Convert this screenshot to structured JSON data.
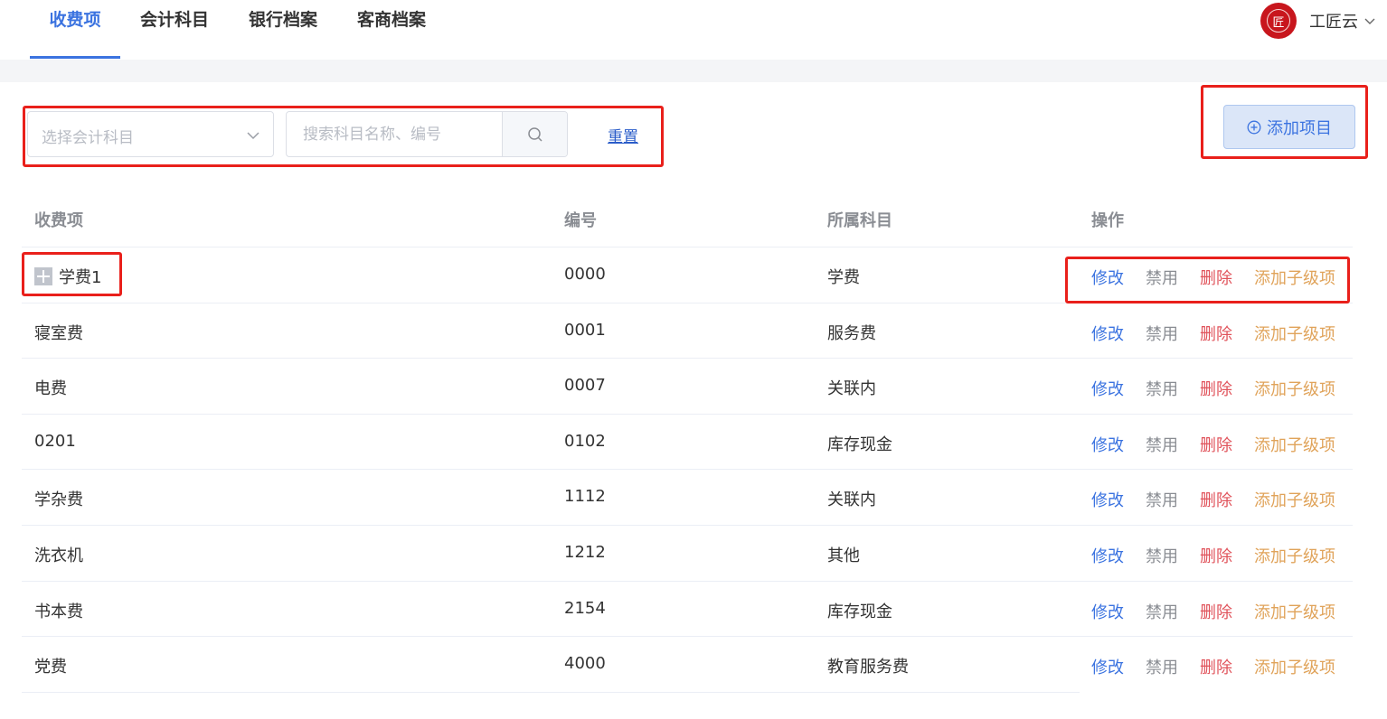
{
  "nav": {
    "tabs": [
      {
        "label": "收费项",
        "active": true
      },
      {
        "label": "会计科目",
        "active": false
      },
      {
        "label": "银行档案",
        "active": false
      },
      {
        "label": "客商档案",
        "active": false
      }
    ]
  },
  "user": {
    "name": "工匠云",
    "logo_text": "匠"
  },
  "filters": {
    "subject_placeholder": "选择会计科目",
    "search_placeholder": "搜索科目名称、编号",
    "reset_label": "重置"
  },
  "actions": {
    "add_label": "添加项目"
  },
  "table": {
    "columns": [
      "收费项",
      "编号",
      "所属科目",
      "操作"
    ],
    "ops": {
      "edit": "修改",
      "disable": "禁用",
      "delete": "删除",
      "add_child": "添加子级项"
    },
    "rows": [
      {
        "name": "学费1",
        "code": "0000",
        "subject": "学费",
        "expandable": true
      },
      {
        "name": "寝室费",
        "code": "0001",
        "subject": "服务费"
      },
      {
        "name": "电费",
        "code": "0007",
        "subject": "关联内"
      },
      {
        "name": "0201",
        "code": "0102",
        "subject": "库存现金"
      },
      {
        "name": "学杂费",
        "code": "1112",
        "subject": "关联内"
      },
      {
        "name": "洗衣机",
        "code": "1212",
        "subject": "其他"
      },
      {
        "name": "书本费",
        "code": "2154",
        "subject": "库存现金"
      },
      {
        "name": "党费",
        "code": "4000",
        "subject": "教育服务费"
      }
    ]
  },
  "colors": {
    "primary": "#3b73e0",
    "danger": "#e0525a",
    "warning": "#e0a35a",
    "highlight": "#e9201b"
  }
}
